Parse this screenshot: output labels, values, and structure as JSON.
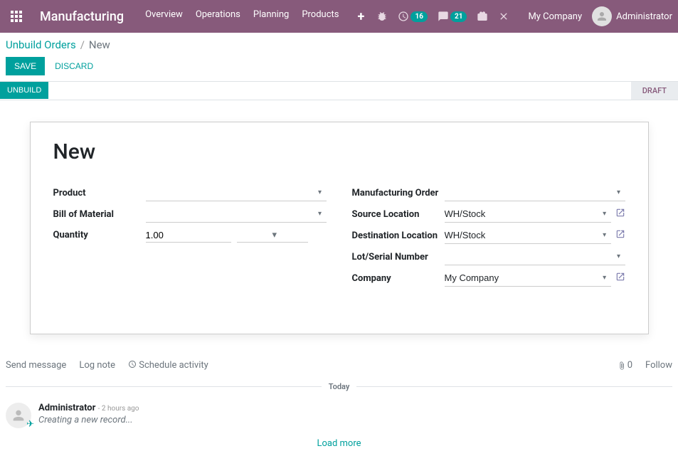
{
  "header": {
    "appName": "Manufacturing",
    "menu": [
      "Overview",
      "Operations",
      "Planning",
      "Products"
    ],
    "badges": {
      "activities": "16",
      "discuss": "21"
    },
    "company": "My Company",
    "user": "Administrator"
  },
  "breadcrumb": {
    "parent": "Unbuild Orders",
    "sep": "/",
    "current": "New"
  },
  "buttons": {
    "save": "Save",
    "discard": "Discard",
    "unbuild": "Unbuild"
  },
  "status": {
    "stage": "Draft"
  },
  "form": {
    "title": "New",
    "left": {
      "productLabel": "Product",
      "productValue": "",
      "bomLabel": "Bill of Material",
      "bomValue": "",
      "quantityLabel": "Quantity",
      "quantityValue": "1.00",
      "uomValue": ""
    },
    "right": {
      "moLabel": "Manufacturing Order",
      "moValue": "",
      "sourceLabel": "Source Location",
      "sourceValue": "WH/Stock",
      "destLabel": "Destination Location",
      "destValue": "WH/Stock",
      "lotLabel": "Lot/Serial Number",
      "lotValue": "",
      "companyLabel": "Company",
      "companyValue": "My Company"
    }
  },
  "chatter": {
    "sendMessage": "Send message",
    "logNote": "Log note",
    "scheduleActivity": "Schedule activity",
    "attachCount": "0",
    "follow": "Follow",
    "separatorLabel": "Today",
    "message": {
      "author": "Administrator",
      "time": "- 2 hours ago",
      "body": "Creating a new record..."
    },
    "loadMore": "Load more"
  }
}
